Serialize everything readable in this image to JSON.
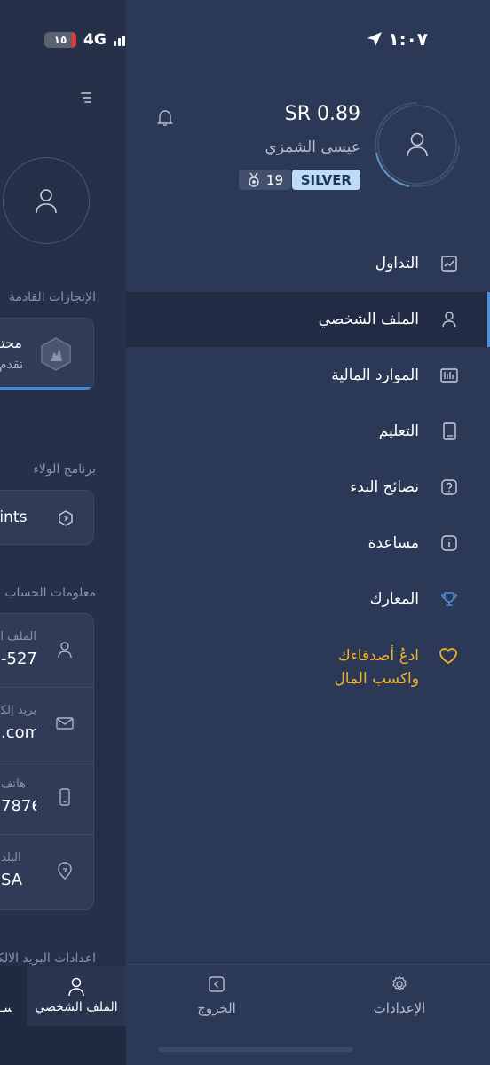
{
  "status_bar": {
    "battery": "١٥",
    "network": "4G",
    "time": "١:٠٧"
  },
  "background_page": {
    "upcoming_achievements_heading": "الإنجازات القادمة",
    "achievement_title": "محترف",
    "achievement_subtitle": "التقدم",
    "loyalty_heading": "برنامج الولاء",
    "loyalty_value": "oints",
    "account_info_heading": "معلومات الحساب",
    "account_rows": [
      {
        "label": "الملف الشخصي",
        "value": "-527",
        "icon": "person-icon"
      },
      {
        "label": "بريد إلكتروني",
        "value": ".com",
        "icon": "mail-icon"
      },
      {
        "label": "هاتف",
        "value": "7876",
        "icon": "phone-icon"
      },
      {
        "label": "البلد",
        "value": "SA",
        "icon": "location-icon"
      }
    ],
    "email_settings_heading": "اعدادات البريد الالكتروني",
    "tab_profile_label": "الملف الشخصي",
    "tab_cut_label": "سـ"
  },
  "drawer": {
    "balance": "SR 0.89",
    "user_name": "عيسى الشمزي",
    "tier": "SILVER",
    "points": "19",
    "nav_items": [
      {
        "label": "التداول",
        "icon": "chart-icon",
        "active": false
      },
      {
        "label": "الملف الشخصي",
        "icon": "person-icon",
        "active": true
      },
      {
        "label": "الموارد المالية",
        "icon": "finance-icon",
        "active": false
      },
      {
        "label": "التعليم",
        "icon": "book-icon",
        "active": false
      },
      {
        "label": "نصائح البدء",
        "icon": "question-icon",
        "active": false
      },
      {
        "label": "مساعدة",
        "icon": "info-icon",
        "active": false
      },
      {
        "label": "المعارك",
        "icon": "trophy-icon",
        "active": false
      }
    ],
    "invite": {
      "line1": "ادعُ أصدقاءك",
      "line2": "واكسب المال"
    },
    "footer": {
      "logout": "الخروج",
      "settings": "الإعدادات"
    }
  },
  "colors": {
    "drawer_bg": "#2c3956",
    "active_bg": "#212b44",
    "accent": "#4a90e2",
    "invite": "#f0b429",
    "tier_bg": "#bfdcf7"
  }
}
